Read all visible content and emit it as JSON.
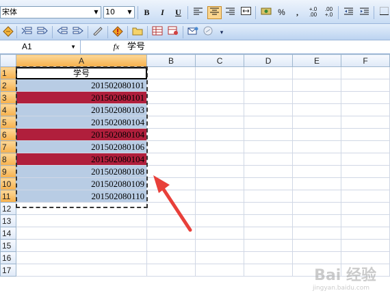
{
  "format_toolbar": {
    "font_name": "宋体",
    "font_size": "10",
    "bold": "B",
    "italic": "I",
    "underline": "U",
    "percent": "%",
    "comma": ",",
    "increase_decimal": "+.0\n.00",
    "decrease_decimal": ".00\n+.0"
  },
  "formula_bar": {
    "name_box": "A1",
    "fx": "fx",
    "content": "学号"
  },
  "grid": {
    "columns": [
      "A",
      "B",
      "C",
      "D",
      "E",
      "F"
    ],
    "rows": [
      {
        "n": "1",
        "a": "学号",
        "style": "hdr"
      },
      {
        "n": "2",
        "a": "201502080101",
        "style": "blue"
      },
      {
        "n": "3",
        "a": "201502080101",
        "style": "red"
      },
      {
        "n": "4",
        "a": "201502080103",
        "style": "blue"
      },
      {
        "n": "5",
        "a": "201502080104",
        "style": "blue"
      },
      {
        "n": "6",
        "a": "201502080104",
        "style": "red"
      },
      {
        "n": "7",
        "a": "201502080106",
        "style": "blue"
      },
      {
        "n": "8",
        "a": "201502080104",
        "style": "red"
      },
      {
        "n": "9",
        "a": "201502080108",
        "style": "blue"
      },
      {
        "n": "10",
        "a": "201502080109",
        "style": "blue"
      },
      {
        "n": "11",
        "a": "201502080110",
        "style": "blue"
      },
      {
        "n": "12",
        "a": "",
        "style": ""
      },
      {
        "n": "13",
        "a": "",
        "style": ""
      },
      {
        "n": "14",
        "a": "",
        "style": ""
      },
      {
        "n": "15",
        "a": "",
        "style": ""
      },
      {
        "n": "16",
        "a": "",
        "style": ""
      },
      {
        "n": "17",
        "a": "",
        "style": ""
      }
    ]
  },
  "colors": {
    "duplicate_fill": "#b01f3c",
    "selection_fill": "#b8cce4",
    "arrow": "#e8403a"
  },
  "watermark": {
    "brand": "Bai 经验",
    "url": "jingyan.baidu.com"
  }
}
